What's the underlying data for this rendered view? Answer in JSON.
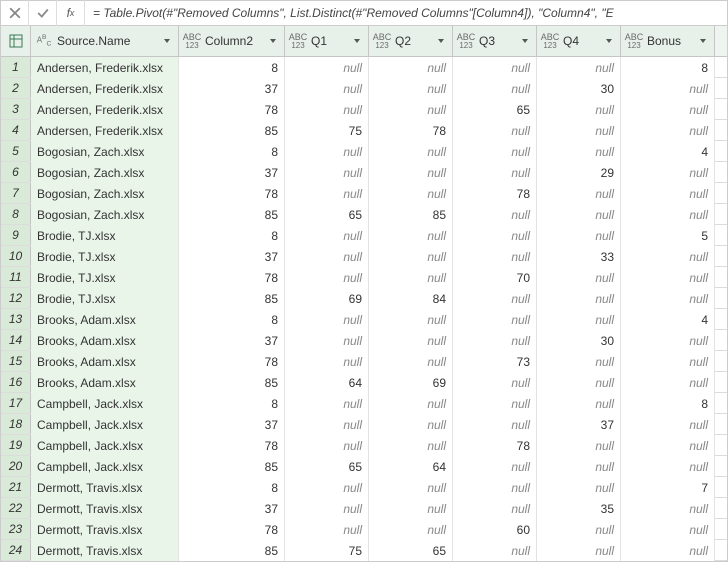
{
  "formula": "= Table.Pivot(#\"Removed Columns\", List.Distinct(#\"Removed Columns\"[Column4]), \"Column4\", \"E",
  "columns": {
    "source": "Source.Name",
    "col2": "Column2",
    "q1": "Q1",
    "q2": "Q2",
    "q3": "Q3",
    "q4": "Q4",
    "bonus": "Bonus"
  },
  "typeLabels": {
    "text": "A B C",
    "any": "ABC",
    "anySub": "123"
  },
  "nullLabel": "null",
  "rows": [
    {
      "n": "1",
      "src": "Andersen, Frederik.xlsx",
      "c2": "8",
      "q1": null,
      "q2": null,
      "q3": null,
      "q4": null,
      "b": "8"
    },
    {
      "n": "2",
      "src": "Andersen, Frederik.xlsx",
      "c2": "37",
      "q1": null,
      "q2": null,
      "q3": null,
      "q4": "30",
      "b": null
    },
    {
      "n": "3",
      "src": "Andersen, Frederik.xlsx",
      "c2": "78",
      "q1": null,
      "q2": null,
      "q3": "65",
      "q4": null,
      "b": null
    },
    {
      "n": "4",
      "src": "Andersen, Frederik.xlsx",
      "c2": "85",
      "q1": "75",
      "q2": "78",
      "q3": null,
      "q4": null,
      "b": null
    },
    {
      "n": "5",
      "src": "Bogosian, Zach.xlsx",
      "c2": "8",
      "q1": null,
      "q2": null,
      "q3": null,
      "q4": null,
      "b": "4"
    },
    {
      "n": "6",
      "src": "Bogosian, Zach.xlsx",
      "c2": "37",
      "q1": null,
      "q2": null,
      "q3": null,
      "q4": "29",
      "b": null
    },
    {
      "n": "7",
      "src": "Bogosian, Zach.xlsx",
      "c2": "78",
      "q1": null,
      "q2": null,
      "q3": "78",
      "q4": null,
      "b": null
    },
    {
      "n": "8",
      "src": "Bogosian, Zach.xlsx",
      "c2": "85",
      "q1": "65",
      "q2": "85",
      "q3": null,
      "q4": null,
      "b": null
    },
    {
      "n": "9",
      "src": "Brodie, TJ.xlsx",
      "c2": "8",
      "q1": null,
      "q2": null,
      "q3": null,
      "q4": null,
      "b": "5"
    },
    {
      "n": "10",
      "src": "Brodie, TJ.xlsx",
      "c2": "37",
      "q1": null,
      "q2": null,
      "q3": null,
      "q4": "33",
      "b": null
    },
    {
      "n": "11",
      "src": "Brodie, TJ.xlsx",
      "c2": "78",
      "q1": null,
      "q2": null,
      "q3": "70",
      "q4": null,
      "b": null
    },
    {
      "n": "12",
      "src": "Brodie, TJ.xlsx",
      "c2": "85",
      "q1": "69",
      "q2": "84",
      "q3": null,
      "q4": null,
      "b": null
    },
    {
      "n": "13",
      "src": "Brooks, Adam.xlsx",
      "c2": "8",
      "q1": null,
      "q2": null,
      "q3": null,
      "q4": null,
      "b": "4"
    },
    {
      "n": "14",
      "src": "Brooks, Adam.xlsx",
      "c2": "37",
      "q1": null,
      "q2": null,
      "q3": null,
      "q4": "30",
      "b": null
    },
    {
      "n": "15",
      "src": "Brooks, Adam.xlsx",
      "c2": "78",
      "q1": null,
      "q2": null,
      "q3": "73",
      "q4": null,
      "b": null
    },
    {
      "n": "16",
      "src": "Brooks, Adam.xlsx",
      "c2": "85",
      "q1": "64",
      "q2": "69",
      "q3": null,
      "q4": null,
      "b": null
    },
    {
      "n": "17",
      "src": "Campbell, Jack.xlsx",
      "c2": "8",
      "q1": null,
      "q2": null,
      "q3": null,
      "q4": null,
      "b": "8"
    },
    {
      "n": "18",
      "src": "Campbell, Jack.xlsx",
      "c2": "37",
      "q1": null,
      "q2": null,
      "q3": null,
      "q4": "37",
      "b": null
    },
    {
      "n": "19",
      "src": "Campbell, Jack.xlsx",
      "c2": "78",
      "q1": null,
      "q2": null,
      "q3": "78",
      "q4": null,
      "b": null
    },
    {
      "n": "20",
      "src": "Campbell, Jack.xlsx",
      "c2": "85",
      "q1": "65",
      "q2": "64",
      "q3": null,
      "q4": null,
      "b": null
    },
    {
      "n": "21",
      "src": "Dermott, Travis.xlsx",
      "c2": "8",
      "q1": null,
      "q2": null,
      "q3": null,
      "q4": null,
      "b": "7"
    },
    {
      "n": "22",
      "src": "Dermott, Travis.xlsx",
      "c2": "37",
      "q1": null,
      "q2": null,
      "q3": null,
      "q4": "35",
      "b": null
    },
    {
      "n": "23",
      "src": "Dermott, Travis.xlsx",
      "c2": "78",
      "q1": null,
      "q2": null,
      "q3": "60",
      "q4": null,
      "b": null
    },
    {
      "n": "24",
      "src": "Dermott, Travis.xlsx",
      "c2": "85",
      "q1": "75",
      "q2": "65",
      "q3": null,
      "q4": null,
      "b": null
    }
  ]
}
